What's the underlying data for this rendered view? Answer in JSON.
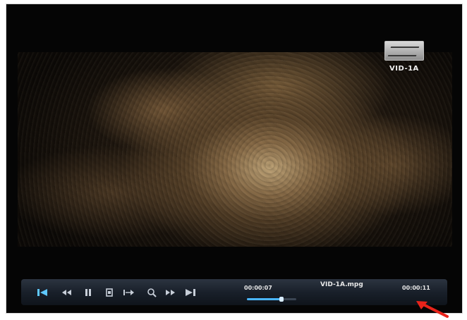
{
  "player": {
    "channel_name": "VID-1A",
    "channel_logo_icon": "broadcaster-logo-icon",
    "file_name": "VID-1A.mpg",
    "elapsed_time": "00:00:07",
    "total_time": "00:00:11",
    "progress_fraction": 0.7,
    "accent_color": "#4ab6ff"
  },
  "controls": [
    {
      "name": "skip-previous",
      "icon": "skip-previous-icon",
      "active": true
    },
    {
      "name": "rewind",
      "icon": "rewind-icon",
      "active": false
    },
    {
      "name": "pause",
      "icon": "pause-icon",
      "active": false
    },
    {
      "name": "stop",
      "icon": "stop-icon",
      "active": false
    },
    {
      "name": "step",
      "icon": "step-icon",
      "active": false
    },
    {
      "name": "zoom",
      "icon": "zoom-icon",
      "active": false
    },
    {
      "name": "fast-forward",
      "icon": "fast-forward-icon",
      "active": false
    },
    {
      "name": "skip-next",
      "icon": "skip-next-icon",
      "active": false
    }
  ],
  "annotation": {
    "arrow_color": "#e8231a",
    "arrow_icon": "annotation-arrow-icon"
  }
}
